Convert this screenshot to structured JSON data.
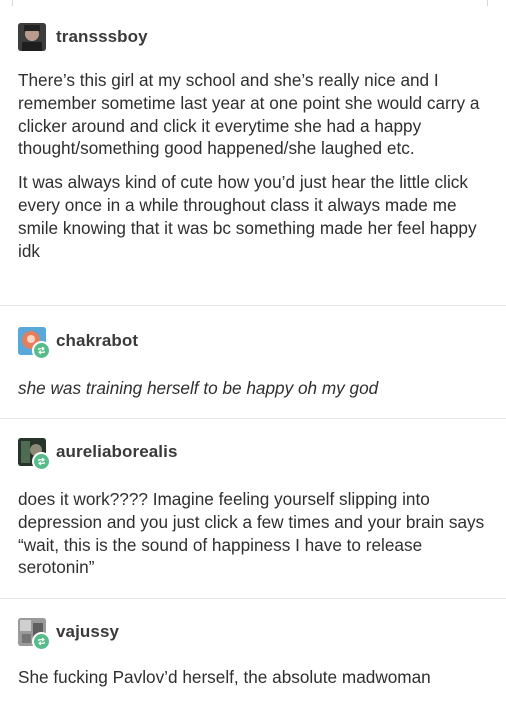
{
  "posts": [
    {
      "username": "transssboy",
      "paragraphs": [
        "There’s this girl at my school and she’s really nice and I remember sometime last year at one point she would carry a clicker around and click it everytime she had a happy thought/something good happened/she laughed etc.",
        "It was always kind of cute how you’d just hear the little click every once in a while throughout class it always made me smile knowing that it was bc something made her feel happy idk"
      ],
      "reblog_icon": false
    },
    {
      "username": "chakrabot",
      "paragraphs": [
        "she was training herself to be happy oh my god"
      ],
      "style": "italic",
      "reblog_icon": true
    },
    {
      "username": "aureliaborealis",
      "paragraphs": [
        "does it work???? Imagine feeling yourself slipping into depression and you just click a few times and your brain says “wait, this is the sound of happiness I have to release serotonin”"
      ],
      "reblog_icon": true
    },
    {
      "username": "vajussy",
      "paragraphs": [
        "She fucking Pavlov’d herself, the absolute madwoman"
      ],
      "reblog_icon": true
    }
  ],
  "icons": {
    "reblog": "reblog-icon",
    "reblog_color": "#56bc8a"
  }
}
